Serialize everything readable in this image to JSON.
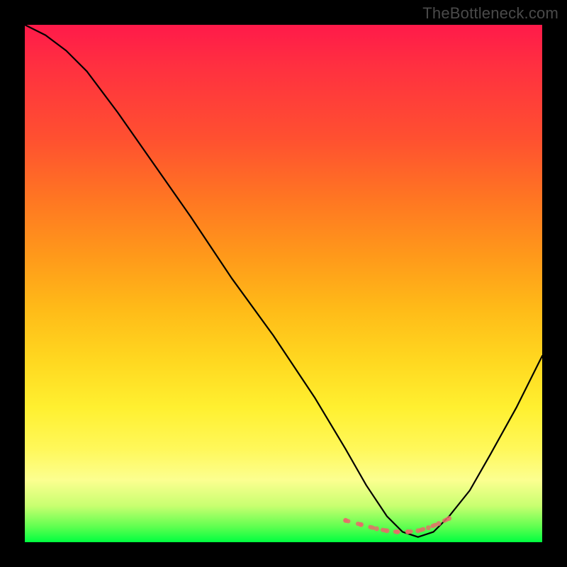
{
  "watermark": "TheBottleneck.com",
  "colors": {
    "curve": "#000000",
    "accent": "#e86a6a",
    "gradient_top": "#ff1a4a",
    "gradient_bottom": "#00ff40"
  },
  "chart_data": {
    "type": "line",
    "title": "",
    "xlabel": "",
    "ylabel": "",
    "xlim": [
      0,
      100
    ],
    "ylim": [
      0,
      100
    ],
    "grid": false,
    "legend": false,
    "description": "Bottleneck percentage curve vs component balance. Y axis represents mismatch (0 at bottom = no bottleneck, 100 at top = full bottleneck). Minimum near x≈73 marks optimal pairing.",
    "series": [
      {
        "name": "bottleneck-curve",
        "color": "#000000",
        "x": [
          0,
          4,
          8,
          12,
          18,
          25,
          32,
          40,
          48,
          56,
          62,
          66,
          70,
          73,
          76,
          79,
          82,
          86,
          90,
          95,
          100
        ],
        "y": [
          100,
          98,
          95,
          91,
          83,
          73,
          63,
          51,
          40,
          28,
          18,
          11,
          5,
          2,
          1,
          2,
          5,
          10,
          17,
          26,
          36
        ]
      },
      {
        "name": "optimal-region-markers",
        "color": "#e86a6a",
        "x": [
          62,
          65,
          68,
          70,
          72,
          74,
          76,
          78,
          80,
          82
        ],
        "y": [
          4.2,
          3.4,
          2.6,
          2.2,
          2.0,
          2.0,
          2.2,
          2.8,
          3.6,
          4.6
        ]
      }
    ]
  }
}
